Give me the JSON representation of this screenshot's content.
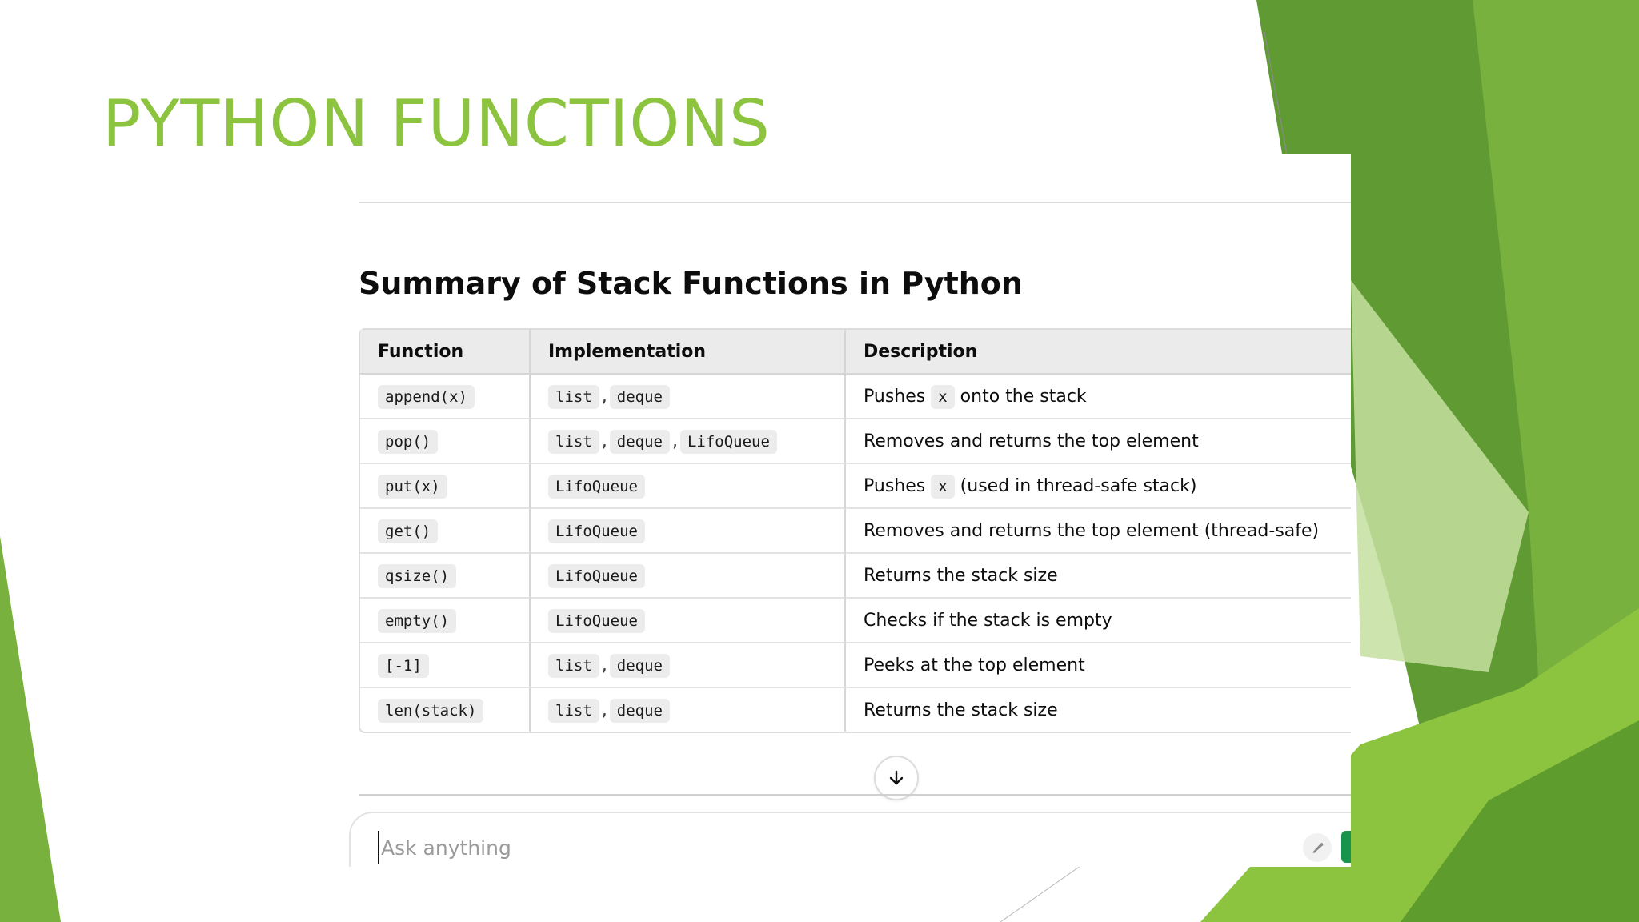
{
  "slide": {
    "title": "PYTHON FUNCTIONS",
    "accent_color": "#8dc43f"
  },
  "chat": {
    "heading": "Summary of Stack Functions in Python",
    "table": {
      "columns": [
        "Function",
        "Implementation",
        "Description"
      ],
      "rows": [
        {
          "function": "append(x)",
          "impl": [
            "list",
            "deque"
          ],
          "desc": [
            "Pushes ",
            "x",
            " onto the stack"
          ]
        },
        {
          "function": "pop()",
          "impl": [
            "list",
            "deque",
            "LifoQueue"
          ],
          "desc": [
            "Removes and returns the top element"
          ]
        },
        {
          "function": "put(x)",
          "impl": [
            "LifoQueue"
          ],
          "desc": [
            "Pushes ",
            "x",
            " (used in thread-safe stack)"
          ]
        },
        {
          "function": "get()",
          "impl": [
            "LifoQueue"
          ],
          "desc": [
            "Removes and returns the top element (thread-safe)"
          ]
        },
        {
          "function": "qsize()",
          "impl": [
            "LifoQueue"
          ],
          "desc": [
            "Returns the stack size"
          ]
        },
        {
          "function": "empty()",
          "impl": [
            "LifoQueue"
          ],
          "desc": [
            "Checks if the stack is empty"
          ]
        },
        {
          "function": "[-1]",
          "impl": [
            "list",
            "deque"
          ],
          "desc": [
            "Peeks at the top element"
          ]
        },
        {
          "function": "len(stack)",
          "impl": [
            "list",
            "deque"
          ],
          "desc": [
            "Returns the stack size"
          ]
        }
      ]
    },
    "scroll_down_icon": "arrow-down-icon",
    "composer": {
      "placeholder": "Ask anything",
      "value": "",
      "mic_icon": "microphone-icon",
      "send_color": "#17954f"
    }
  }
}
